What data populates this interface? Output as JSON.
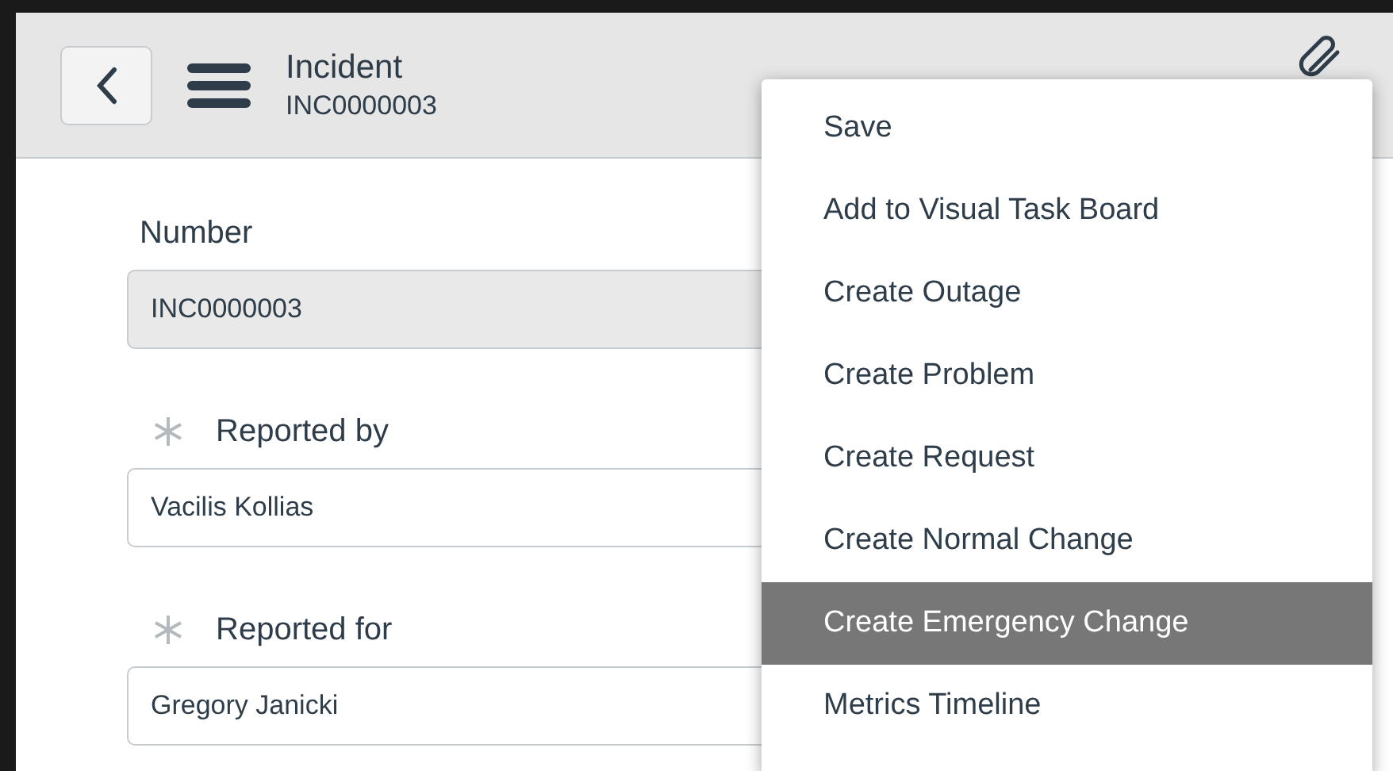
{
  "header": {
    "title": "Incident",
    "subtitle": "INC0000003"
  },
  "fields": [
    {
      "label": "Number",
      "value": "INC0000003",
      "required": false,
      "readonly": true
    },
    {
      "label": "Reported by",
      "value": "Vacilis Kollias",
      "required": true,
      "readonly": false
    },
    {
      "label": "Reported for",
      "value": "Gregory Janicki",
      "required": true,
      "readonly": false
    }
  ],
  "menu": {
    "items": [
      {
        "label": "Save",
        "selected": false
      },
      {
        "label": "Add to Visual Task Board",
        "selected": false
      },
      {
        "label": "Create Outage",
        "selected": false
      },
      {
        "label": "Create Problem",
        "selected": false
      },
      {
        "label": "Create Request",
        "selected": false
      },
      {
        "label": "Create Normal Change",
        "selected": false
      },
      {
        "label": "Create Emergency Change",
        "selected": true
      },
      {
        "label": "Metrics Timeline",
        "selected": false
      }
    ]
  }
}
